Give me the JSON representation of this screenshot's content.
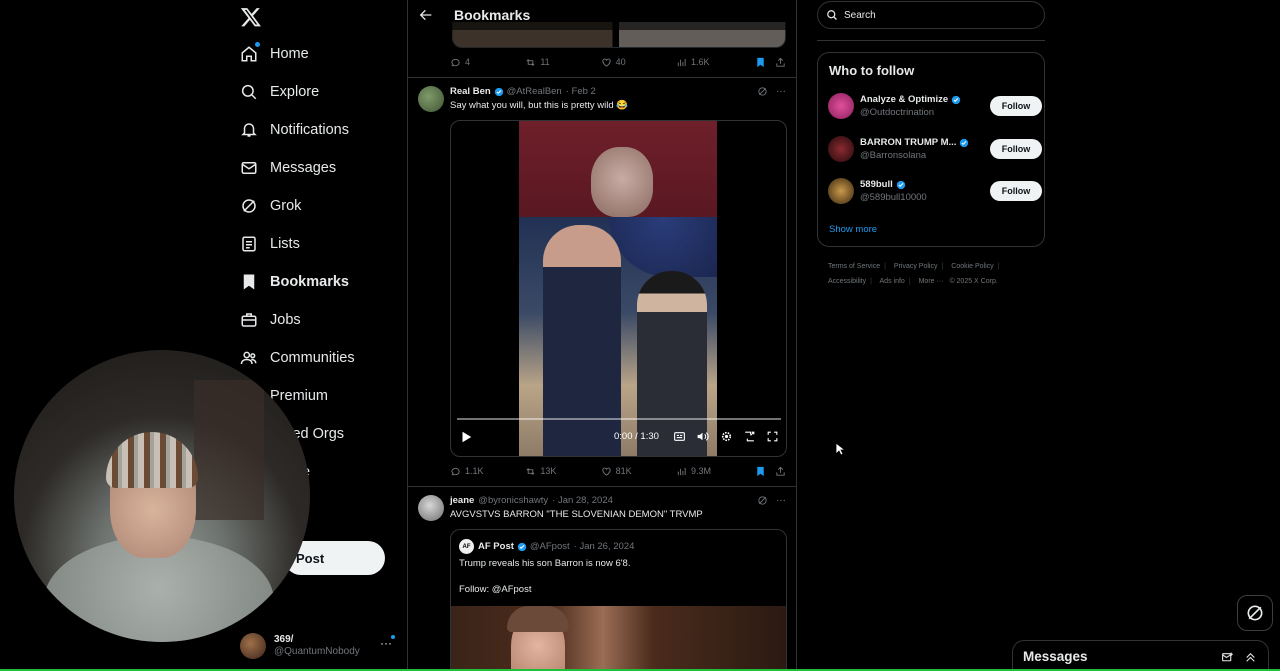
{
  "nav": {
    "items": [
      {
        "label": "Home",
        "icon": "home-icon"
      },
      {
        "label": "Explore",
        "icon": "search-icon"
      },
      {
        "label": "Notifications",
        "icon": "bell-icon"
      },
      {
        "label": "Messages",
        "icon": "envelope-icon"
      },
      {
        "label": "Grok",
        "icon": "grok-icon"
      },
      {
        "label": "Lists",
        "icon": "list-icon"
      },
      {
        "label": "Bookmarks",
        "icon": "bookmark-icon"
      },
      {
        "label": "Jobs",
        "icon": "briefcase-icon"
      },
      {
        "label": "Communities",
        "icon": "people-icon"
      },
      {
        "label": "Premium",
        "icon": "x-icon"
      },
      {
        "label": "ified Orgs",
        "icon": "lightning-icon"
      },
      {
        "label": "e",
        "icon": "more-icon"
      }
    ],
    "post_label": "Post",
    "account": {
      "name": "369/",
      "handle": "@QuantumNobody"
    }
  },
  "header": {
    "title": "Bookmarks"
  },
  "prev_tweet": {
    "replies": "4",
    "reposts": "11",
    "likes": "40",
    "views": "1.6K"
  },
  "tweet1": {
    "name": "Real Ben",
    "handle": "@AtRealBen",
    "date": "· Feb 2",
    "text": "Say what you will, but this is pretty wild 😂",
    "video_time": "0:00 / 1:30",
    "replies": "1.1K",
    "reposts": "13K",
    "likes": "81K",
    "views": "9.3M"
  },
  "tweet2": {
    "name": "jeane",
    "handle": "@byronicshawty",
    "date": "· Jan 28, 2024",
    "text": "AVGVSTVS BARRON \"THE SLOVENIAN DEMON\" TRVMP",
    "quote": {
      "avatar_text": "AF",
      "name": "AF Post",
      "handle": "@AFpost",
      "date": "· Jan 26, 2024",
      "text1": "Trump reveals his son Barron is now 6'8.",
      "text2": "Follow: @AFpost"
    }
  },
  "search": {
    "placeholder": "Search"
  },
  "who_to_follow": {
    "title": "Who to follow",
    "users": [
      {
        "name": "Analyze & Optimize",
        "handle": "@Outdoctrination",
        "button": "Follow",
        "avatar_color": "#c0368a"
      },
      {
        "name": "BARRON TRUMP M...",
        "handle": "@Barronsolana",
        "button": "Follow",
        "avatar_color": "#3a1214"
      },
      {
        "name": "589bull",
        "handle": "@589bull10000",
        "button": "Follow",
        "avatar_color": "#6b4a1c"
      }
    ],
    "show_more": "Show more"
  },
  "footer": {
    "links": [
      "Terms of Service",
      "Privacy Policy",
      "Cookie Policy",
      "Accessibility",
      "Ads info",
      "More ···"
    ],
    "copyright": "© 2025 X Corp."
  },
  "dock": {
    "title": "Messages"
  },
  "colors": {
    "accent": "#1d9bf0",
    "text": "#e7e9ea",
    "muted": "#71767b",
    "border": "#2f3336"
  }
}
